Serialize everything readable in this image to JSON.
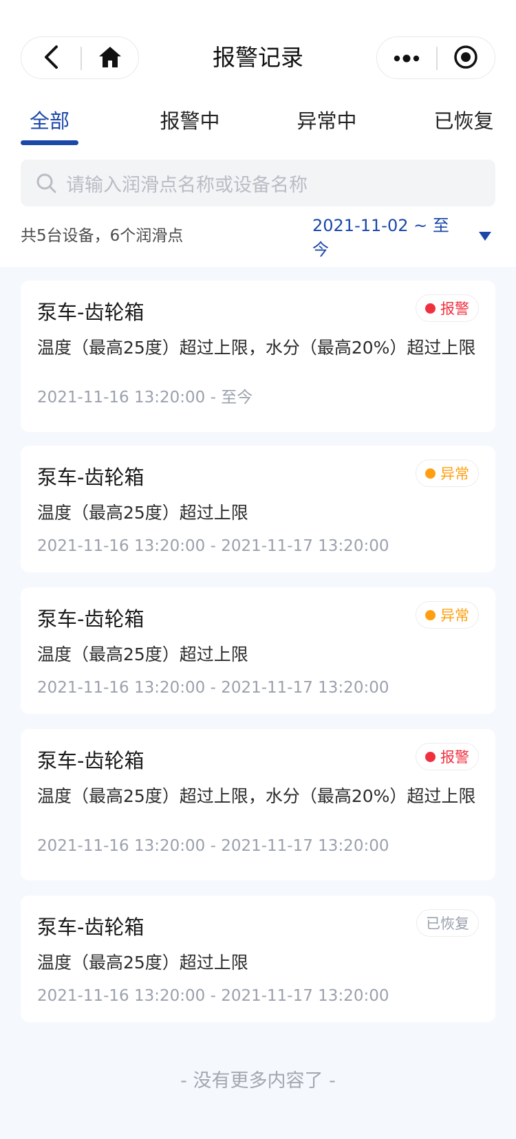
{
  "header": {
    "title": "报警记录",
    "back_icon": "back-arrow-icon",
    "home_icon": "home-icon",
    "more_icon": "more-dots-icon",
    "target_icon": "record-target-icon"
  },
  "tabs": [
    {
      "label": "全部",
      "active": true
    },
    {
      "label": "报警中",
      "active": false
    },
    {
      "label": "异常中",
      "active": false
    },
    {
      "label": "已恢复",
      "active": false
    }
  ],
  "search": {
    "placeholder": "请输入润滑点名称或设备名称"
  },
  "summary": {
    "text": "共5台设备，6个润滑点"
  },
  "date_filter": {
    "label": "2021-11-02 ~ 至今"
  },
  "colors": {
    "accent": "#1a47a8",
    "alarm": "#f0303f",
    "abnormal": "#ff9f0f",
    "recovered": "#9aa0ac"
  },
  "records": [
    {
      "title": "泵车-齿轮箱",
      "status": "报警",
      "status_type": "alarm",
      "desc": "温度（最高25度）超过上限，水分（最高20%）超过上限",
      "time": "2021-11-16 13:20:00 - 至今"
    },
    {
      "title": "泵车-齿轮箱",
      "status": "异常",
      "status_type": "abnormal",
      "desc": "温度（最高25度）超过上限",
      "time": "2021-11-16 13:20:00 - 2021-11-17 13:20:00"
    },
    {
      "title": "泵车-齿轮箱",
      "status": "异常",
      "status_type": "abnormal",
      "desc": "温度（最高25度）超过上限",
      "time": "2021-11-16 13:20:00 - 2021-11-17 13:20:00"
    },
    {
      "title": "泵车-齿轮箱",
      "status": "报警",
      "status_type": "alarm",
      "desc": "温度（最高25度）超过上限，水分（最高20%）超过上限",
      "time": "2021-11-16 13:20:00 - 2021-11-17 13:20:00"
    },
    {
      "title": "泵车-齿轮箱",
      "status": "已恢复",
      "status_type": "recovered",
      "desc": "温度（最高25度）超过上限",
      "time": "2021-11-16 13:20:00 - 2021-11-17 13:20:00"
    }
  ],
  "footer": {
    "text": "- 没有更多内容了 -"
  }
}
